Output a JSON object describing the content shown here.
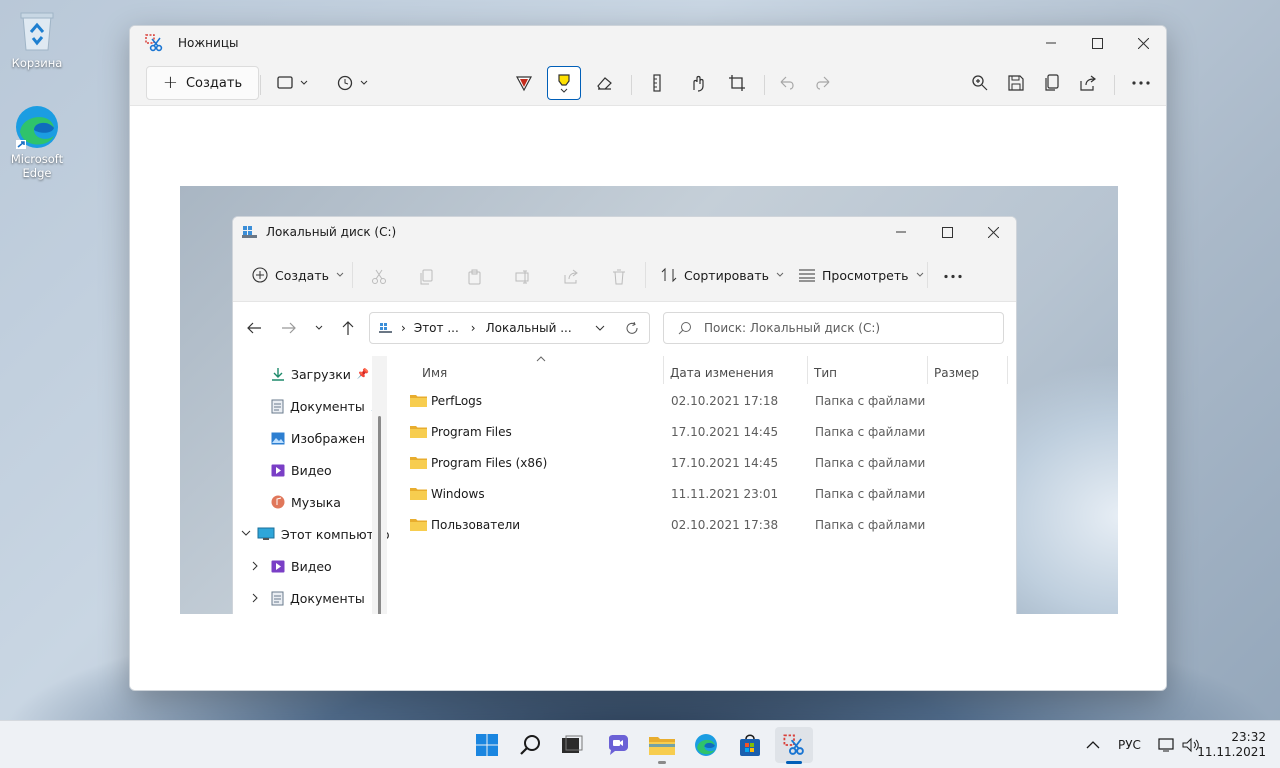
{
  "desktop": {
    "icons": [
      {
        "label": "Корзина"
      },
      {
        "label": "Microsoft Edge"
      }
    ]
  },
  "snip": {
    "title": "Ножницы",
    "new_label": "Создать",
    "icons": [
      "snip-mode-icon",
      "delay-icon",
      "ballpoint-pen-icon",
      "highlighter-icon",
      "eraser-icon",
      "ruler-icon",
      "touch-writing-icon",
      "crop-icon",
      "undo-icon",
      "redo-icon",
      "zoom-icon",
      "save-icon",
      "copy-icon",
      "share-icon",
      "more-icon"
    ]
  },
  "explorer": {
    "title": "Локальный диск (C:)",
    "cmd": {
      "new_label": "Создать",
      "sort_label": "Сортировать",
      "view_label": "Просмотреть"
    },
    "address": {
      "crumb1": "Этот ...",
      "crumb2": "Локальный ..."
    },
    "search_placeholder": "Поиск: Локальный диск (C:)",
    "nav": [
      {
        "label": "Загрузки"
      },
      {
        "label": "Документы"
      },
      {
        "label": "Изображен"
      },
      {
        "label": "Видео"
      },
      {
        "label": "Музыка"
      },
      {
        "label": "Этот компьютер"
      },
      {
        "label": "Видео"
      },
      {
        "label": "Документы"
      }
    ],
    "columns": {
      "name": "Имя",
      "date": "Дата изменения",
      "type": "Тип",
      "size": "Размер"
    },
    "rows": [
      {
        "name": "PerfLogs",
        "date": "02.10.2021 17:18",
        "type": "Папка с файлами"
      },
      {
        "name": "Program Files",
        "date": "17.10.2021 14:45",
        "type": "Папка с файлами"
      },
      {
        "name": "Program Files (x86)",
        "date": "17.10.2021 14:45",
        "type": "Папка с файлами"
      },
      {
        "name": "Windows",
        "date": "11.11.2021 23:01",
        "type": "Папка с файлами"
      },
      {
        "name": "Пользователи",
        "date": "02.10.2021 17:38",
        "type": "Папка с файлами"
      }
    ]
  },
  "taskbar": {
    "lang": "РУС",
    "time": "23:32",
    "date": "11.11.2021"
  },
  "colors": {
    "accent": "#005fb8",
    "folder": "#f3c23d"
  }
}
